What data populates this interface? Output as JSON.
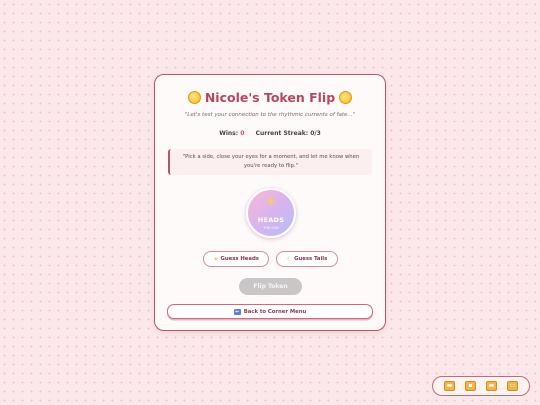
{
  "title": "Nicole's Token Flip",
  "icons": {
    "title_left": "coin-icon",
    "title_right": "coin-icon",
    "coin_face": "sun-icon",
    "heads_button": "sun-icon",
    "tails_button": "moon-icon",
    "back_button": "back-arrow-icon"
  },
  "subtitle": "\"Let's test your connection to the rhythmic currents of fate...\"",
  "stats": {
    "wins_label": "Wins:",
    "wins_value": "0",
    "streak_label": "Current Streak:",
    "streak_value": "0/3"
  },
  "message": "\"Pick a side, close your eyes for a moment, and let me know when you're ready to flip.\"",
  "coin": {
    "face_label": "HEADS",
    "face_sublabel": "THE SUN",
    "symbol": "☀"
  },
  "buttons": {
    "guess_heads": "Guess Heads",
    "guess_tails": "Guess Tails",
    "flip": "Flip Token",
    "back": "Back to Corner Menu"
  },
  "dock": {
    "buttons": [
      "dock-button-1",
      "dock-button-2",
      "dock-button-3",
      "dock-button-4"
    ]
  },
  "colors": {
    "accent": "#b24a5e",
    "coin_gradient_start": "#f9b8d6",
    "coin_gradient_end": "#b4c0f5",
    "background": "#fce8ea"
  }
}
